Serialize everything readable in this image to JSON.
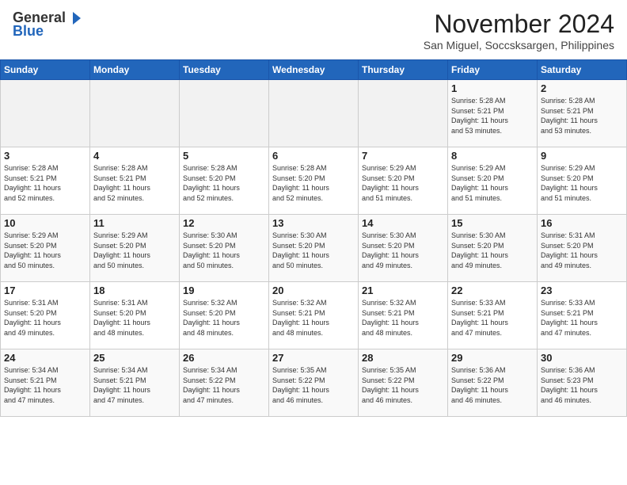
{
  "header": {
    "logo_general": "General",
    "logo_blue": "Blue",
    "month_year": "November 2024",
    "location": "San Miguel, Soccsksargen, Philippines"
  },
  "weekdays": [
    "Sunday",
    "Monday",
    "Tuesday",
    "Wednesday",
    "Thursday",
    "Friday",
    "Saturday"
  ],
  "weeks": [
    [
      {
        "day": "",
        "detail": ""
      },
      {
        "day": "",
        "detail": ""
      },
      {
        "day": "",
        "detail": ""
      },
      {
        "day": "",
        "detail": ""
      },
      {
        "day": "",
        "detail": ""
      },
      {
        "day": "1",
        "detail": "Sunrise: 5:28 AM\nSunset: 5:21 PM\nDaylight: 11 hours\nand 53 minutes."
      },
      {
        "day": "2",
        "detail": "Sunrise: 5:28 AM\nSunset: 5:21 PM\nDaylight: 11 hours\nand 53 minutes."
      }
    ],
    [
      {
        "day": "3",
        "detail": "Sunrise: 5:28 AM\nSunset: 5:21 PM\nDaylight: 11 hours\nand 52 minutes."
      },
      {
        "day": "4",
        "detail": "Sunrise: 5:28 AM\nSunset: 5:21 PM\nDaylight: 11 hours\nand 52 minutes."
      },
      {
        "day": "5",
        "detail": "Sunrise: 5:28 AM\nSunset: 5:20 PM\nDaylight: 11 hours\nand 52 minutes."
      },
      {
        "day": "6",
        "detail": "Sunrise: 5:28 AM\nSunset: 5:20 PM\nDaylight: 11 hours\nand 52 minutes."
      },
      {
        "day": "7",
        "detail": "Sunrise: 5:29 AM\nSunset: 5:20 PM\nDaylight: 11 hours\nand 51 minutes."
      },
      {
        "day": "8",
        "detail": "Sunrise: 5:29 AM\nSunset: 5:20 PM\nDaylight: 11 hours\nand 51 minutes."
      },
      {
        "day": "9",
        "detail": "Sunrise: 5:29 AM\nSunset: 5:20 PM\nDaylight: 11 hours\nand 51 minutes."
      }
    ],
    [
      {
        "day": "10",
        "detail": "Sunrise: 5:29 AM\nSunset: 5:20 PM\nDaylight: 11 hours\nand 50 minutes."
      },
      {
        "day": "11",
        "detail": "Sunrise: 5:29 AM\nSunset: 5:20 PM\nDaylight: 11 hours\nand 50 minutes."
      },
      {
        "day": "12",
        "detail": "Sunrise: 5:30 AM\nSunset: 5:20 PM\nDaylight: 11 hours\nand 50 minutes."
      },
      {
        "day": "13",
        "detail": "Sunrise: 5:30 AM\nSunset: 5:20 PM\nDaylight: 11 hours\nand 50 minutes."
      },
      {
        "day": "14",
        "detail": "Sunrise: 5:30 AM\nSunset: 5:20 PM\nDaylight: 11 hours\nand 49 minutes."
      },
      {
        "day": "15",
        "detail": "Sunrise: 5:30 AM\nSunset: 5:20 PM\nDaylight: 11 hours\nand 49 minutes."
      },
      {
        "day": "16",
        "detail": "Sunrise: 5:31 AM\nSunset: 5:20 PM\nDaylight: 11 hours\nand 49 minutes."
      }
    ],
    [
      {
        "day": "17",
        "detail": "Sunrise: 5:31 AM\nSunset: 5:20 PM\nDaylight: 11 hours\nand 49 minutes."
      },
      {
        "day": "18",
        "detail": "Sunrise: 5:31 AM\nSunset: 5:20 PM\nDaylight: 11 hours\nand 48 minutes."
      },
      {
        "day": "19",
        "detail": "Sunrise: 5:32 AM\nSunset: 5:20 PM\nDaylight: 11 hours\nand 48 minutes."
      },
      {
        "day": "20",
        "detail": "Sunrise: 5:32 AM\nSunset: 5:21 PM\nDaylight: 11 hours\nand 48 minutes."
      },
      {
        "day": "21",
        "detail": "Sunrise: 5:32 AM\nSunset: 5:21 PM\nDaylight: 11 hours\nand 48 minutes."
      },
      {
        "day": "22",
        "detail": "Sunrise: 5:33 AM\nSunset: 5:21 PM\nDaylight: 11 hours\nand 47 minutes."
      },
      {
        "day": "23",
        "detail": "Sunrise: 5:33 AM\nSunset: 5:21 PM\nDaylight: 11 hours\nand 47 minutes."
      }
    ],
    [
      {
        "day": "24",
        "detail": "Sunrise: 5:34 AM\nSunset: 5:21 PM\nDaylight: 11 hours\nand 47 minutes."
      },
      {
        "day": "25",
        "detail": "Sunrise: 5:34 AM\nSunset: 5:21 PM\nDaylight: 11 hours\nand 47 minutes."
      },
      {
        "day": "26",
        "detail": "Sunrise: 5:34 AM\nSunset: 5:22 PM\nDaylight: 11 hours\nand 47 minutes."
      },
      {
        "day": "27",
        "detail": "Sunrise: 5:35 AM\nSunset: 5:22 PM\nDaylight: 11 hours\nand 46 minutes."
      },
      {
        "day": "28",
        "detail": "Sunrise: 5:35 AM\nSunset: 5:22 PM\nDaylight: 11 hours\nand 46 minutes."
      },
      {
        "day": "29",
        "detail": "Sunrise: 5:36 AM\nSunset: 5:22 PM\nDaylight: 11 hours\nand 46 minutes."
      },
      {
        "day": "30",
        "detail": "Sunrise: 5:36 AM\nSunset: 5:23 PM\nDaylight: 11 hours\nand 46 minutes."
      }
    ]
  ]
}
